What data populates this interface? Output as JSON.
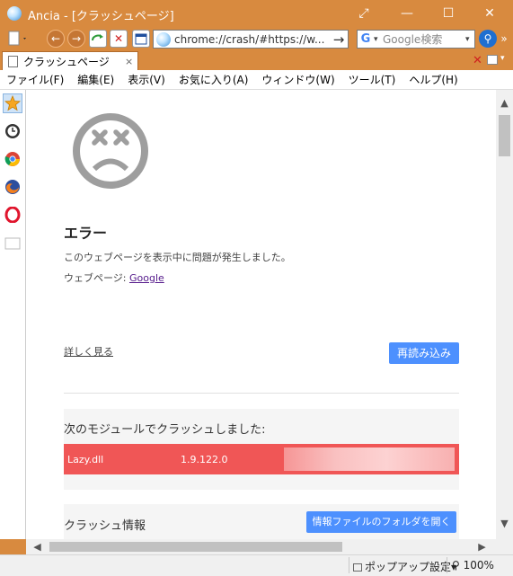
{
  "window": {
    "title": "Ancia - [クラッシュページ]",
    "controls": {
      "restore": "⤢",
      "minimize": "—",
      "maximize": "☐",
      "close": "✕"
    }
  },
  "toolbar": {
    "address": "chrome://crash/#https://w...",
    "go": "→",
    "search_placeholder": "Google検索",
    "search_engine_icon": "G",
    "more": "»"
  },
  "tab": {
    "label": "クラッシュページ",
    "close": "×"
  },
  "menu": {
    "items": [
      "ファイル(F)",
      "編集(E)",
      "表示(V)",
      "お気に入り(A)",
      "ウィンドウ(W)",
      "ツール(T)",
      "ヘルプ(H)"
    ]
  },
  "sidebar": {
    "icons": [
      "star-icon",
      "clock-icon",
      "chrome-icon",
      "firefox-icon",
      "opera-icon",
      "blank-page-icon"
    ]
  },
  "error": {
    "title": "エラー",
    "description": "このウェブページを表示中に問題が発生しました。",
    "page_label": "ウェブページ: ",
    "page_link": "Google",
    "learn_more": "詳しく見る",
    "reload": "再読み込み"
  },
  "modules": {
    "heading": "次のモジュールでクラッシュしました:",
    "rows": [
      {
        "name": "Lazy.dll",
        "version": "1.9.122.0"
      }
    ]
  },
  "crash_info": {
    "heading": "クラッシュ情報",
    "open_folder": "情報ファイルのフォルダを開く"
  },
  "statusbar": {
    "popup": "ポップアップ設定▾",
    "zoom": "100%"
  },
  "colors": {
    "chrome": "#d88a3f",
    "accent": "#4d90fe",
    "crash_row": "#f05656"
  }
}
